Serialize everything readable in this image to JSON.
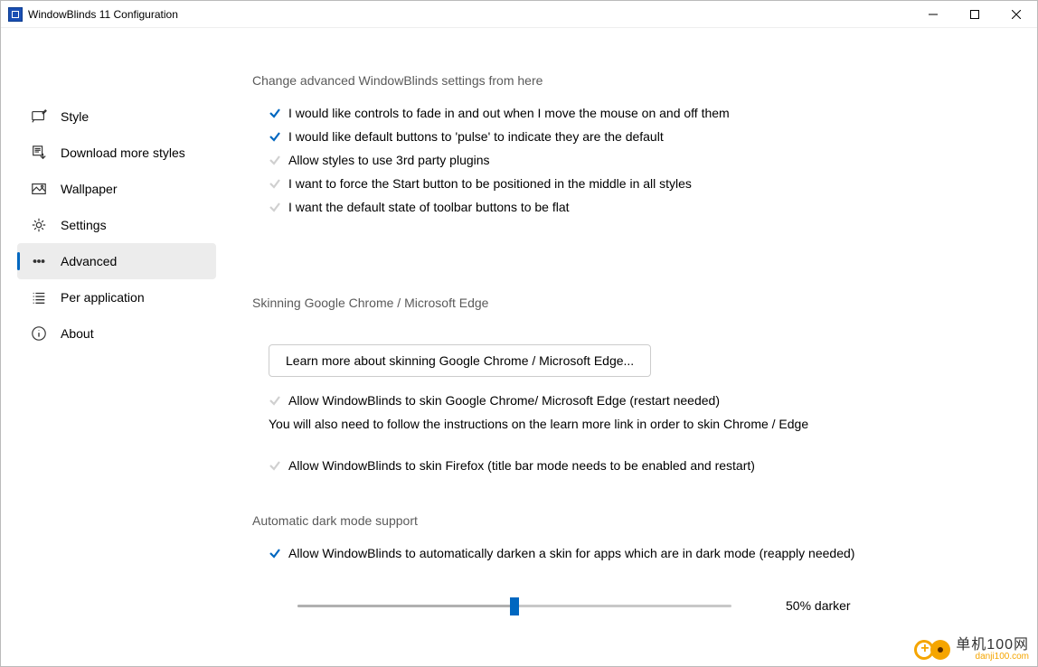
{
  "window": {
    "title": "WindowBlinds 11 Configuration"
  },
  "sidebar": {
    "items": [
      {
        "label": "Style"
      },
      {
        "label": "Download more styles"
      },
      {
        "label": "Wallpaper"
      },
      {
        "label": "Settings"
      },
      {
        "label": "Advanced"
      },
      {
        "label": "Per application"
      },
      {
        "label": "About"
      }
    ]
  },
  "main": {
    "section1_title": "Change advanced WindowBlinds settings from here",
    "opts": [
      {
        "checked": true,
        "label": "I would like controls to fade in and out when I move the mouse on and off them"
      },
      {
        "checked": true,
        "label": "I would like default buttons to 'pulse' to indicate they are the default"
      },
      {
        "checked": false,
        "label": "Allow styles to use 3rd party plugins"
      },
      {
        "checked": false,
        "label": "I want to force the Start button to be positioned in the middle in all styles"
      },
      {
        "checked": false,
        "label": "I want the default state of toolbar buttons to be flat"
      }
    ],
    "section2_title": "Skinning Google Chrome / Microsoft Edge",
    "learn_more_btn": "Learn more about skinning Google Chrome / Microsoft Edge...",
    "skin_chrome": {
      "checked": false,
      "label": "Allow WindowBlinds to skin Google Chrome/ Microsoft Edge (restart needed)"
    },
    "chrome_note": "You will also need to follow the instructions on the learn more link in order to skin Chrome / Edge",
    "skin_firefox": {
      "checked": false,
      "label": "Allow WindowBlinds to skin Firefox (title bar mode needs to be enabled and restart)"
    },
    "section3_title": "Automatic dark mode support",
    "dark_mode": {
      "checked": true,
      "label": "Allow WindowBlinds to automatically darken a skin for apps which are in dark mode (reapply needed)"
    },
    "slider_percent": 50,
    "slider_label": "50% darker"
  },
  "watermark": {
    "text_main": "单机100网",
    "text_sub": "danji100.com"
  }
}
